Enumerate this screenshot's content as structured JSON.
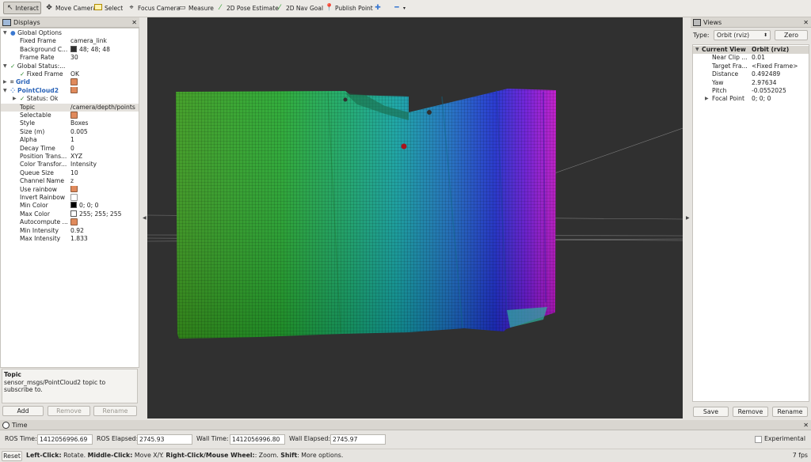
{
  "toolbar": {
    "tools": [
      {
        "label": "Interact",
        "icon": "cursor-icon"
      },
      {
        "label": "Move Camera",
        "icon": "move-icon"
      },
      {
        "label": "Select",
        "icon": "select-icon"
      },
      {
        "label": "Focus Camera",
        "icon": "focus-icon"
      },
      {
        "label": "Measure",
        "icon": "ruler-icon"
      },
      {
        "label": "2D Pose Estimate",
        "icon": "green-arrow-icon"
      },
      {
        "label": "2D Nav Goal",
        "icon": "green-arrow-icon"
      },
      {
        "label": "Publish Point",
        "icon": "pin-icon"
      }
    ]
  },
  "displays": {
    "title": "Displays",
    "global_options": "Global Options",
    "fixed_frame_label": "Fixed Frame",
    "fixed_frame": "camera_link",
    "background_label": "Background C...",
    "background": "48; 48; 48",
    "frame_rate_label": "Frame Rate",
    "frame_rate": "30",
    "global_status": "Global Status:...",
    "fixed_frame_status_label": "Fixed Frame",
    "fixed_frame_status": "OK",
    "grid": "Grid",
    "pointcloud": "PointCloud2",
    "status_ok": "Status: Ok",
    "props": [
      {
        "k": "Topic",
        "v": "/camera/depth/points"
      },
      {
        "k": "Selectable",
        "cb": true
      },
      {
        "k": "Style",
        "v": "Boxes"
      },
      {
        "k": "Size (m)",
        "v": "0.005"
      },
      {
        "k": "Alpha",
        "v": "1"
      },
      {
        "k": "Decay Time",
        "v": "0"
      },
      {
        "k": "Position Trans...",
        "v": "XYZ"
      },
      {
        "k": "Color Transfor...",
        "v": "Intensity"
      },
      {
        "k": "Queue Size",
        "v": "10"
      },
      {
        "k": "Channel Name",
        "v": "z"
      },
      {
        "k": "Use rainbow",
        "cb": true
      },
      {
        "k": "Invert Rainbow",
        "cb": false
      },
      {
        "k": "Min Color",
        "v": "0; 0; 0",
        "swatch": "#000000"
      },
      {
        "k": "Max Color",
        "v": "255; 255; 255",
        "swatch": "#ffffff"
      },
      {
        "k": "Autocompute ...",
        "cb": true
      },
      {
        "k": "Min Intensity",
        "v": "0.92"
      },
      {
        "k": "Max Intensity",
        "v": "1.833"
      }
    ],
    "desc_title": "Topic",
    "desc_text": "sensor_msgs/PointCloud2 topic to subscribe to.",
    "add": "Add",
    "remove": "Remove",
    "rename": "Rename"
  },
  "views": {
    "title": "Views",
    "type_label": "Type:",
    "type_value": "Orbit (rviz)",
    "zero": "Zero",
    "current_view": "Current View",
    "current_type": "Orbit (rviz)",
    "props": [
      {
        "k": "Near Clip ...",
        "v": "0.01"
      },
      {
        "k": "Target Fra...",
        "v": "<Fixed Frame>"
      },
      {
        "k": "Distance",
        "v": "0.492489"
      },
      {
        "k": "Yaw",
        "v": "2.97634"
      },
      {
        "k": "Pitch",
        "v": "-0.0552025"
      },
      {
        "k": "Focal Point",
        "v": "0; 0; 0"
      }
    ],
    "save": "Save",
    "remove": "Remove",
    "rename": "Rename"
  },
  "time": {
    "title": "Time",
    "ros_time_label": "ROS Time:",
    "ros_time": "1412056996.69",
    "ros_elapsed_label": "ROS Elapsed:",
    "ros_elapsed": "2745.93",
    "wall_time_label": "Wall Time:",
    "wall_time": "1412056996.80",
    "wall_elapsed_label": "Wall Elapsed:",
    "wall_elapsed": "2745.97",
    "experimental": "Experimental"
  },
  "status": {
    "reset": "Reset",
    "hint_b1": "Left-Click:",
    "hint_t1": " Rotate. ",
    "hint_b2": "Middle-Click:",
    "hint_t2": " Move X/Y. ",
    "hint_b3": "Right-Click/Mouse Wheel:",
    "hint_t3": ": Zoom. ",
    "hint_b4": "Shift",
    "hint_t4": ": More options.",
    "fps": "7 fps"
  },
  "colors": {
    "accent": "#2a63b8",
    "view_bg": "#303030",
    "checkbox": "#e08a5c"
  }
}
